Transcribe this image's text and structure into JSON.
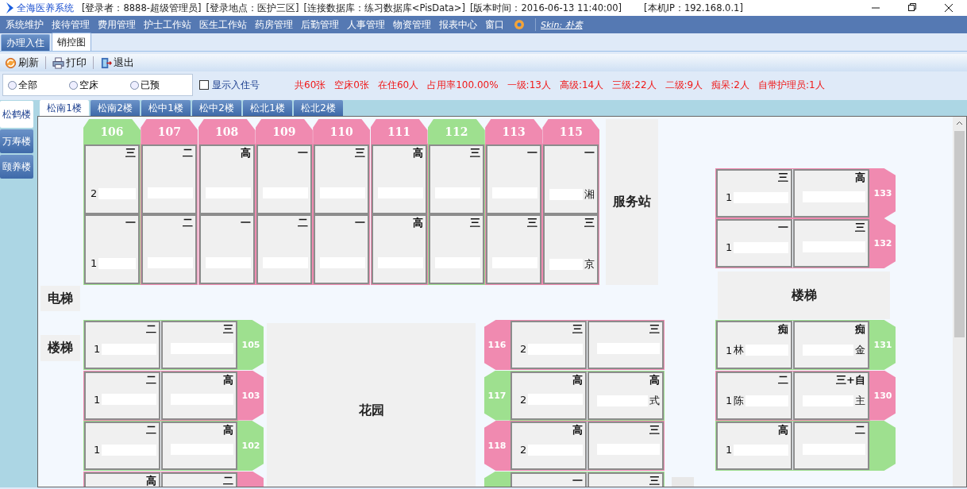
{
  "title_bar": {
    "app_name": "全海医养系统",
    "info": [
      "[登录者：8888-超级管理员]",
      "[登录地点：医护三区]",
      "[连接数据库：练习数据库<PisData>]",
      "[版本时间：2016-06-13 11:40:00]"
    ],
    "ip": "[本机IP：192.168.0.1]"
  },
  "menu": {
    "items": [
      "系统维护",
      "接待管理",
      "费用管理",
      "护士工作站",
      "医生工作站",
      "药房管理",
      "后勤管理",
      "人事管理",
      "物资管理",
      "报表中心",
      "窗口"
    ],
    "skin_link": "Skin: 朴素"
  },
  "tabs": [
    {
      "label": "办理入住",
      "selected": false
    },
    {
      "label": "销控图",
      "selected": true
    }
  ],
  "toolbar": [
    {
      "kind": "refresh",
      "label": "刷新"
    },
    {
      "kind": "print",
      "label": "打印"
    },
    {
      "kind": "exit",
      "label": "退出"
    }
  ],
  "filters": {
    "radios": [
      {
        "label": "全部",
        "selected": false
      },
      {
        "label": "空床",
        "selected": false
      },
      {
        "label": "已预",
        "selected": false
      }
    ],
    "checkbox": {
      "label": "显示入住号",
      "checked": false
    }
  },
  "stats": [
    "共60张",
    "空床0张",
    "在住60人",
    "占用率100.00%",
    "一级:13人",
    "高级:14人",
    "三级:22人",
    "二级:9人",
    "痴呆:2人",
    "自带护理员:1人"
  ],
  "buildings": [
    {
      "label": "松鹤楼",
      "selected": true
    },
    {
      "label": "万寿楼",
      "selected": false
    },
    {
      "label": "颐养楼",
      "selected": false
    }
  ],
  "floors": [
    {
      "label": "松南1楼",
      "selected": true
    },
    {
      "label": "松南2楼",
      "selected": false
    },
    {
      "label": "松中1楼",
      "selected": false
    },
    {
      "label": "松中2楼",
      "selected": false
    },
    {
      "label": "松北1楼",
      "selected": false
    },
    {
      "label": "松北2楼",
      "selected": false
    }
  ],
  "floor_plan": {
    "landmarks": [
      {
        "kind": "service",
        "label": "服务站"
      },
      {
        "kind": "elevator",
        "label": "电梯"
      },
      {
        "kind": "stairs_left",
        "label": "楼梯"
      },
      {
        "kind": "stairs_right",
        "label": "楼梯"
      },
      {
        "kind": "garden",
        "label": "花园"
      }
    ],
    "rooms": [
      {
        "number": "106",
        "color": "#9ee08f",
        "kind": "top",
        "beds": [
          {
            "level": "三",
            "bed_no": "2"
          },
          {
            "level": "一",
            "bed_no": "1"
          }
        ]
      },
      {
        "number": "107",
        "color": "#f08ab0",
        "kind": "top",
        "beds": [
          {
            "level": "二"
          },
          {
            "level": "二"
          }
        ]
      },
      {
        "number": "108",
        "color": "#f08ab0",
        "kind": "top",
        "beds": [
          {
            "level": "高"
          },
          {
            "level": "一"
          }
        ]
      },
      {
        "number": "109",
        "color": "#f08ab0",
        "kind": "top",
        "beds": [
          {
            "level": "一"
          },
          {
            "level": "二"
          }
        ]
      },
      {
        "number": "110",
        "color": "#f08ab0",
        "kind": "top",
        "beds": [
          {
            "level": "三"
          },
          {
            "level": "一"
          }
        ]
      },
      {
        "number": "111",
        "color": "#f08ab0",
        "kind": "top",
        "beds": [
          {
            "level": "高"
          },
          {
            "level": "高"
          }
        ]
      },
      {
        "number": "112",
        "color": "#9ee08f",
        "kind": "top",
        "beds": [
          {
            "level": "三"
          },
          {
            "level": "三"
          }
        ]
      },
      {
        "number": "113",
        "color": "#f08ab0",
        "kind": "top",
        "beds": [
          {
            "level": "一"
          },
          {
            "level": "三"
          }
        ]
      },
      {
        "number": "115",
        "color": "#f08ab0",
        "kind": "top",
        "beds": [
          {
            "level": "一",
            "name_end": "湘"
          },
          {
            "level": "三",
            "name_end": "京"
          }
        ]
      },
      {
        "number": "133",
        "color": "#f08ab0",
        "kind": "right_upper",
        "beds": [
          {
            "level": "三",
            "bed_no": "1"
          },
          {
            "level": "高"
          }
        ]
      },
      {
        "number": "132",
        "color": "#f08ab0",
        "kind": "right_upper",
        "beds": [
          {
            "level": "一",
            "bed_no": "1"
          },
          {
            "level": "三"
          }
        ]
      },
      {
        "number": "105",
        "color": "#9ee08f",
        "kind": "left",
        "beds": [
          {
            "level": "二",
            "bed_no": "1"
          },
          {
            "level": "三"
          }
        ]
      },
      {
        "number": "103",
        "color": "#f08ab0",
        "kind": "left",
        "beds": [
          {
            "level": "二",
            "bed_no": "1"
          },
          {
            "level": "高"
          }
        ]
      },
      {
        "number": "102",
        "color": "#9ee08f",
        "kind": "left",
        "beds": [
          {
            "level": "二",
            "bed_no": "1"
          },
          {
            "level": "高"
          }
        ]
      },
      {
        "color": "#f08ab0",
        "kind": "left",
        "beds": [
          {
            "level": "高"
          },
          {
            "level": "二"
          }
        ]
      },
      {
        "number": "116",
        "color": "#f08ab0",
        "kind": "middle",
        "beds": [
          {
            "level": "三",
            "bed_no": "2"
          },
          {
            "level": "三"
          }
        ]
      },
      {
        "number": "117",
        "color": "#9ee08f",
        "kind": "middle",
        "beds": [
          {
            "level": "高",
            "bed_no": "2"
          },
          {
            "level": "高",
            "name_end": "式"
          }
        ]
      },
      {
        "number": "118",
        "color": "#f08ab0",
        "kind": "middle",
        "beds": [
          {
            "level": "高",
            "bed_no": "2"
          },
          {
            "level": "三"
          }
        ]
      },
      {
        "color": "#9ee08f",
        "kind": "middle",
        "beds": [
          {
            "level": "一"
          },
          {
            "level": "三"
          }
        ]
      },
      {
        "number": "131",
        "color": "#9ee08f",
        "kind": "right_lower",
        "beds": [
          {
            "level": "痴",
            "bed_no": "1",
            "name_start": "林"
          },
          {
            "level": "痴",
            "name_end": "金"
          }
        ]
      },
      {
        "number": "130",
        "color": "#f08ab0",
        "kind": "right_lower",
        "beds": [
          {
            "level": "二",
            "bed_no": "1",
            "name_start": "陈"
          },
          {
            "level": "三+自",
            "name_end": "主"
          }
        ]
      },
      {
        "color": "#9ee08f",
        "kind": "right_lower",
        "beds": [
          {
            "level": "高",
            "bed_no": "1"
          },
          {
            "level": "二"
          }
        ]
      }
    ]
  }
}
